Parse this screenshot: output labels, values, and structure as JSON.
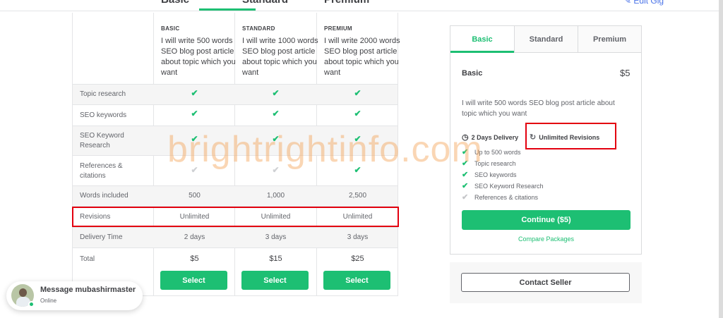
{
  "top": {
    "cut_labels": [
      "Basic",
      "Standard",
      "Premium"
    ],
    "right_link": "Edit Gig"
  },
  "table": {
    "packages": [
      {
        "cap": "BASIC",
        "desc": "I will write 500 words SEO blog post article about topic which you want"
      },
      {
        "cap": "STANDARD",
        "desc": "I will write 1000 words SEO blog post article about topic which you want"
      },
      {
        "cap": "PREMIUM",
        "desc": "I will write 2000 words SEO blog post article about topic which you want"
      }
    ],
    "rows": {
      "topic_research": "Topic research",
      "seo_keywords": "SEO keywords",
      "seo_keyword_research": "SEO Keyword Research",
      "references": "References & citations",
      "words_included": "Words included",
      "revisions": "Revisions",
      "delivery_time": "Delivery Time",
      "total": "Total"
    },
    "words": [
      "500",
      "1,000",
      "2,500"
    ],
    "revisions": [
      "Unlimited",
      "Unlimited",
      "Unlimited"
    ],
    "delivery": [
      "2 days",
      "3 days",
      "3 days"
    ],
    "prices": [
      "$5",
      "$15",
      "$25"
    ],
    "select_label": "Select",
    "check_glyph": "✔"
  },
  "panel": {
    "tabs": [
      "Basic",
      "Standard",
      "Premium"
    ],
    "title": "Basic",
    "price": "$5",
    "description": "I will write 500 words SEO blog post article about topic which you want",
    "delivery": "2 Days Delivery",
    "revisions": "Unlimited Revisions",
    "features": [
      "Up to 500 words",
      "Topic research",
      "SEO keywords",
      "SEO Keyword Research",
      "References & citations"
    ],
    "continue_label": "Continue ($5)",
    "compare_label": "Compare Packages"
  },
  "contact": {
    "label": "Contact Seller"
  },
  "message": {
    "title": "Message mubashirmaster",
    "status": "Online"
  },
  "watermark": "brightrightinfo.com",
  "colors": {
    "accent": "#1dbf73",
    "highlight": "#e3000f",
    "text": "#404145"
  }
}
